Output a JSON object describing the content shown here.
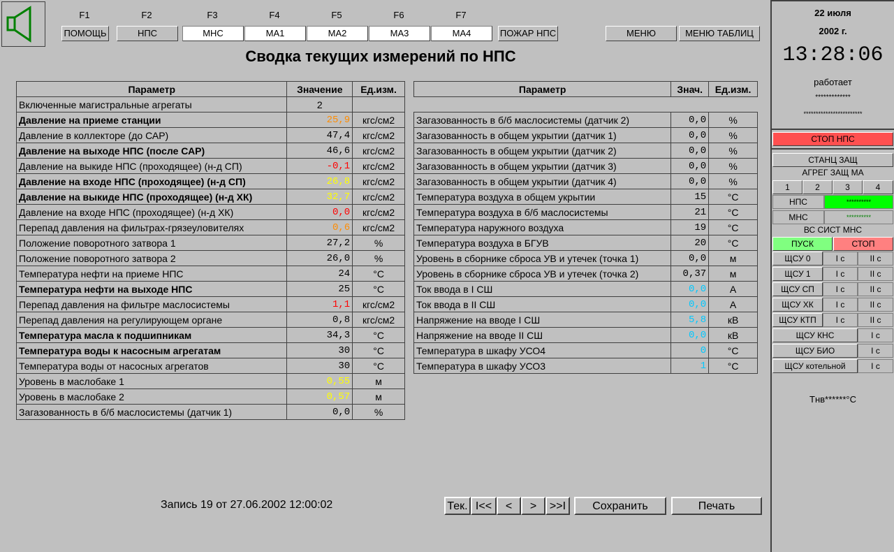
{
  "fkeys": [
    {
      "key": "F1",
      "label": "ПОМОЩЬ"
    },
    {
      "key": "F2",
      "label": "НПС"
    },
    {
      "key": "F3",
      "label": "МНС"
    },
    {
      "key": "F4",
      "label": "МА1"
    },
    {
      "key": "F5",
      "label": "МА2"
    },
    {
      "key": "F6",
      "label": "МА3"
    },
    {
      "key": "F7",
      "label": "МА4"
    }
  ],
  "toolbar": {
    "fire_label": "ПОЖАР НПС",
    "menu_label": "МЕНЮ",
    "menu_tables_label": "МЕНЮ ТАБЛИЦ"
  },
  "title": "Сводка текущих измерений по НПС",
  "left_table": {
    "headers": [
      "Параметр",
      "Значение",
      "Ед.изм."
    ],
    "rows": [
      {
        "param": "Включенные магистральные агрегаты",
        "value": "2",
        "unit": "",
        "bold": false,
        "color": "#000000"
      },
      {
        "param": "Давление на приеме станции",
        "value": "25,9",
        "unit": "кгс/см2",
        "bold": true,
        "color": "#ff8c00"
      },
      {
        "param": "Давление в коллекторе (до САР)",
        "value": "47,4",
        "unit": "кгс/см2",
        "bold": false,
        "color": "#000000"
      },
      {
        "param": "Давление на выходе НПС (после САР)",
        "value": "46,6",
        "unit": "кгс/см2",
        "bold": true,
        "color": "#000000"
      },
      {
        "param": "Давление на выкиде НПС (проходящее) (н-д СП)",
        "value": "-0,1",
        "unit": "кгс/см2",
        "bold": false,
        "color": "#ff0000"
      },
      {
        "param": "Давление на входе НПС (проходящее) (н-д СП)",
        "value": "26,8",
        "unit": "кгс/см2",
        "bold": true,
        "color": "#ffff00"
      },
      {
        "param": "Давление на выкиде НПС (проходящее) (н-д ХК)",
        "value": "32,7",
        "unit": "кгс/см2",
        "bold": true,
        "color": "#ffff00"
      },
      {
        "param": "Давление на входе НПС (проходящее) (н-д ХК)",
        "value": "0,0",
        "unit": "кгс/см2",
        "bold": false,
        "color": "#ff0000"
      },
      {
        "param": "Перепад давления на фильтрах-грязеуловителях",
        "value": "0,6",
        "unit": "кгс/см2",
        "bold": false,
        "color": "#ff8c00"
      },
      {
        "param": "Положение поворотного затвора 1",
        "value": "27,2",
        "unit": "%",
        "bold": false,
        "color": "#000000"
      },
      {
        "param": "Положение поворотного затвора 2",
        "value": "26,0",
        "unit": "%",
        "bold": false,
        "color": "#000000"
      },
      {
        "param": "Температура нефти на приеме НПС",
        "value": "24",
        "unit": "°С",
        "bold": false,
        "color": "#000000"
      },
      {
        "param": "Температура нефти на выходе НПС",
        "value": "25",
        "unit": "°С",
        "bold": true,
        "color": "#000000"
      },
      {
        "param": "Перепад давления на фильтре маслосистемы",
        "value": "1,1",
        "unit": "кгс/см2",
        "bold": false,
        "color": "#ff0000"
      },
      {
        "param": "Перепад давления на регулирующем органе",
        "value": "0,8",
        "unit": "кгс/см2",
        "bold": false,
        "color": "#000000"
      },
      {
        "param": "Температура масла к подшипникам",
        "value": "34,3",
        "unit": "°С",
        "bold": true,
        "color": "#000000"
      },
      {
        "param": "Температура воды к насосным агрегатам",
        "value": "30",
        "unit": "°С",
        "bold": true,
        "color": "#000000"
      },
      {
        "param": "Температура воды от насосных агрегатов",
        "value": "30",
        "unit": "°С",
        "bold": false,
        "color": "#000000"
      },
      {
        "param": "Уровень в маслобаке 1",
        "value": "0,55",
        "unit": "м",
        "bold": false,
        "color": "#ffff00"
      },
      {
        "param": "Уровень в маслобаке 2",
        "value": "0,57",
        "unit": "м",
        "bold": false,
        "color": "#ffff00"
      },
      {
        "param": "Загазованность в б/б маслосистемы (датчик 1)",
        "value": "0,0",
        "unit": "%",
        "bold": false,
        "color": "#000000"
      }
    ]
  },
  "right_table": {
    "headers": [
      "Параметр",
      "Знач.",
      "Ед.изм."
    ],
    "rows": [
      {
        "param": "Загазованность в б/б маслосистемы (датчик 2)",
        "value": "0,0",
        "unit": "%",
        "color": "#000000"
      },
      {
        "param": "Загазованность в общем укрытии (датчик 1)",
        "value": "0,0",
        "unit": "%",
        "color": "#000000"
      },
      {
        "param": "Загазованность в общем укрытии (датчик 2)",
        "value": "0,0",
        "unit": "%",
        "color": "#000000"
      },
      {
        "param": "Загазованность в общем укрытии (датчик 3)",
        "value": "0,0",
        "unit": "%",
        "color": "#000000"
      },
      {
        "param": "Загазованность в общем укрытии (датчик 4)",
        "value": "0,0",
        "unit": "%",
        "color": "#000000"
      },
      {
        "param": "Температура воздуха в общем укрытии",
        "value": "15",
        "unit": "°С",
        "color": "#000000"
      },
      {
        "param": "Температура воздуха в б/б маслосистемы",
        "value": "21",
        "unit": "°С",
        "color": "#000000"
      },
      {
        "param": "Температура наружного воздуха",
        "value": "19",
        "unit": "°С",
        "color": "#000000"
      },
      {
        "param": "Температура воздуха в БГУВ",
        "value": "20",
        "unit": "°С",
        "color": "#000000"
      },
      {
        "param": "Уровень в сборнике сброса УВ и утечек (точка 1)",
        "value": "0,0",
        "unit": "м",
        "color": "#000000"
      },
      {
        "param": "Уровень в сборнике сброса УВ и утечек (точка 2)",
        "value": "0,37",
        "unit": "м",
        "color": "#000000"
      },
      {
        "param": "Ток ввода в I СШ",
        "value": "0,0",
        "unit": "А",
        "color": "#00c8ff"
      },
      {
        "param": "Ток ввода в II СШ",
        "value": "0,0",
        "unit": "А",
        "color": "#00c8ff"
      },
      {
        "param": "Напряжение на вводе I СШ",
        "value": "5,8",
        "unit": "кВ",
        "color": "#00c8ff"
      },
      {
        "param": "Напряжение на вводе II СШ",
        "value": "0,0",
        "unit": "кВ",
        "color": "#00c8ff"
      },
      {
        "param": "Температура в шкафу УСО4",
        "value": "0",
        "unit": "°С",
        "color": "#00c8ff"
      },
      {
        "param": "Температура в шкафу УСО3",
        "value": "1",
        "unit": "°С",
        "color": "#00c8ff"
      }
    ]
  },
  "record_text": "Запись 19 от 27.06.2002  12:00:02",
  "nav": {
    "current": "Тек.",
    "first": "I<<",
    "prev": "<",
    "next": ">",
    "last": ">>I",
    "save": "Сохранить",
    "print": "Печать"
  },
  "side": {
    "date_day": "22 июля",
    "date_year": "2002 г.",
    "time": "13:28:06",
    "status": "работает",
    "stars1": "*************",
    "stars2": "************************",
    "stop_nps": "СТОП НПС",
    "stanc_zasch": "СТАНЦ ЗАЩ",
    "agreg_zasch": "АГРЕГ ЗАЩ МА",
    "agreg_buttons": [
      "1",
      "2",
      "3",
      "4"
    ],
    "nps_label": "НПС",
    "nps_value": "**********",
    "mns_label": "МНС",
    "mns_value": "**********",
    "vs_sist": "ВС СИСТ МНС",
    "pusk": "ПУСК",
    "stop": "СТОП",
    "shchu": [
      {
        "name": "ЩСУ 0",
        "c1": "I с",
        "c2": "II с"
      },
      {
        "name": "ЩСУ 1",
        "c1": "I с",
        "c2": "II с"
      },
      {
        "name": "ЩСУ СП",
        "c1": "I с",
        "c2": "II с"
      },
      {
        "name": "ЩСУ ХК",
        "c1": "I с",
        "c2": "II с"
      },
      {
        "name": "ЩСУ КТП",
        "c1": "I с",
        "c2": "II с"
      }
    ],
    "shchu2": [
      {
        "name": "ЩСУ КНС",
        "c1": "I с"
      },
      {
        "name": "ЩСУ БИО",
        "c1": "I с"
      },
      {
        "name": "ЩСУ котельной",
        "c1": "I с"
      }
    ],
    "tnv": "Тнв******°С"
  },
  "colors": {
    "stop_red": "#ff5050",
    "green": "#00ff00",
    "pink": "#ff8080",
    "light_green": "#80ff80"
  }
}
